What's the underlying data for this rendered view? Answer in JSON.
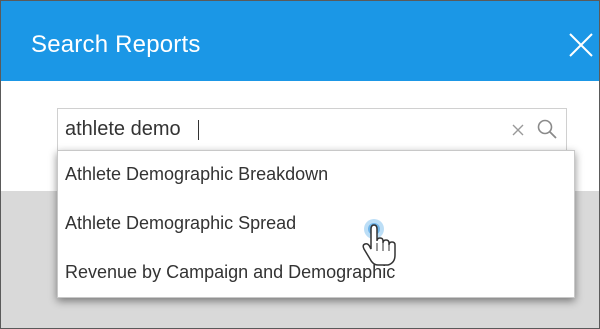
{
  "dialog": {
    "title": "Search Reports",
    "close_icon": "close-icon"
  },
  "search": {
    "value": "athlete demo",
    "clear_icon": "clear-icon",
    "search_icon": "search-icon"
  },
  "results": [
    {
      "label": "Athlete Demographic Breakdown"
    },
    {
      "label": "Athlete Demographic Spread"
    },
    {
      "label": "Revenue by Campaign and Demographic"
    }
  ],
  "colors": {
    "header": "#1b97e6",
    "overlay": "#d9d9d9",
    "text": "#333333"
  }
}
